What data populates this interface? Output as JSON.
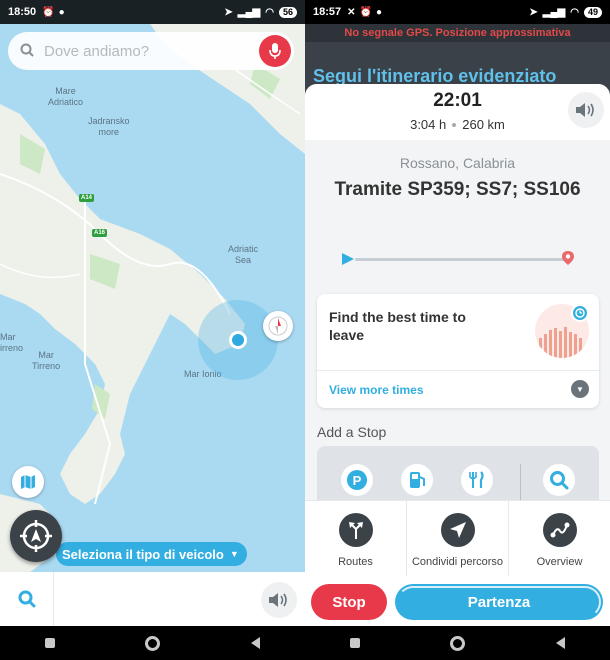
{
  "left_screen": {
    "status": {
      "time": "18:50",
      "battery": "56"
    },
    "search": {
      "placeholder": "Dove andiamo?"
    },
    "map_labels": {
      "mare_adriatico": "Mare\nAdriatico",
      "jadransko_more": "Jadransko\nmore",
      "adriatic_sea": "Adriatic\nSea",
      "mar_tirreno_1": "Mar\nirreno",
      "mar_tirreno_2": "Mar\nTirreno",
      "mar_ionio": "Mar Ionio",
      "shield_a14": "A14",
      "shield_a16": "A16"
    },
    "vehicle_pill": {
      "label": "Seleziona il tipo di veicolo"
    }
  },
  "right_screen": {
    "status": {
      "time": "18:57",
      "battery": "49"
    },
    "gps_warning": "No segnale GPS. Posizione approssimativa",
    "follow_header": "Segui l'itinerario evidenziato",
    "eta": "22:01",
    "duration": "3:04 h",
    "distance": "260 km",
    "destination": "Rossano, Calabria",
    "via": "Tramite SP359; SS7; SS106",
    "route_progress": 0,
    "best_time_card": {
      "title": "Find the best time to leave",
      "more_link": "View more times"
    },
    "add_stop_label": "Add a Stop",
    "actions": [
      {
        "label": "Routes"
      },
      {
        "label": "Condividi percorso"
      },
      {
        "label": "Overview"
      }
    ],
    "stop_button": "Stop",
    "go_button": "Partenza"
  },
  "colors": {
    "accent": "#33aee0",
    "danger": "#e8394a",
    "sea": "#aadaf2",
    "land": "#eef0ea",
    "dark": "#3b4248"
  }
}
